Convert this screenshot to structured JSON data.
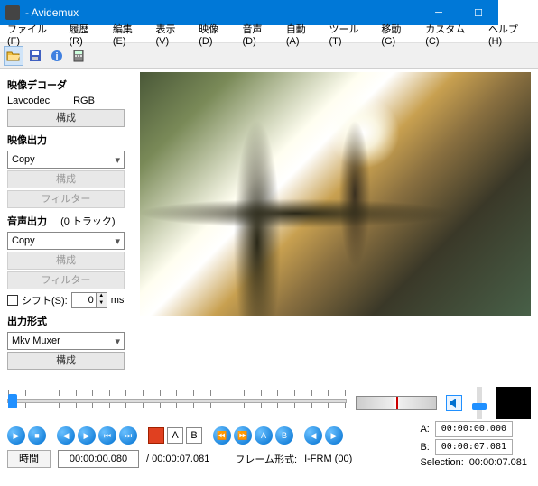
{
  "window": {
    "title": "- Avidemux"
  },
  "menu": [
    "ファイル(F)",
    "履歴(R)",
    "編集(E)",
    "表示(V)",
    "映像(D)",
    "音声(D)",
    "自動(A)",
    "ツール(T)",
    "移動(G)",
    "カスタム(C)",
    "ヘルプ(H)"
  ],
  "sidebar": {
    "decoder": {
      "heading": "映像デコーダ",
      "codec": "Lavcodec",
      "colorspace": "RGB",
      "configure": "構成"
    },
    "video_out": {
      "heading": "映像出力",
      "selected": "Copy",
      "configure": "構成",
      "filter": "フィルター"
    },
    "audio_out": {
      "heading": "音声出力",
      "tracks": "(0 トラック)",
      "selected": "Copy",
      "configure": "構成",
      "filter": "フィルター"
    },
    "shift": {
      "label": "シフト(S):",
      "value": "0",
      "unit": "ms"
    },
    "output_fmt": {
      "heading": "出力形式",
      "selected": "Mkv Muxer",
      "configure": "構成"
    }
  },
  "status": {
    "time_label": "時間",
    "current_time": "00:00:00.080",
    "total_time": "/ 00:00:07.081",
    "frame_label": "フレーム形式:",
    "frame_type": "I-FRM (00)"
  },
  "ab": {
    "a_label": "A:",
    "a_value": "00:00:00.000",
    "b_label": "B:",
    "b_value": "00:00:07.081",
    "selection_label": "Selection:",
    "selection_value": "00:00:07.081"
  }
}
